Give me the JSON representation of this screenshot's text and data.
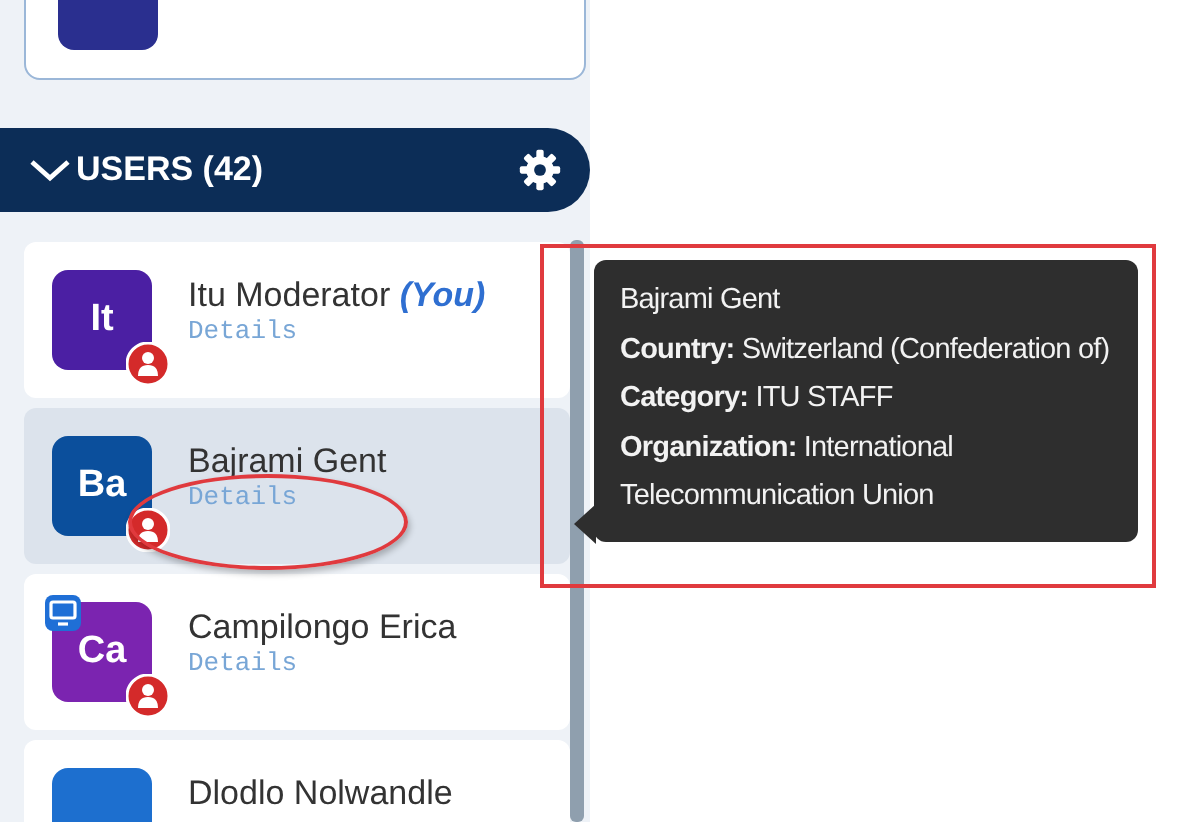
{
  "users_section": {
    "title": "USERS (42)",
    "expanded": true
  },
  "users": [
    {
      "initials": "It",
      "color": "#4b1fa3",
      "name": "Itu Moderator",
      "you_label": "(You)",
      "details": "Details",
      "selected": false,
      "screen_sharing": false
    },
    {
      "initials": "Ba",
      "color": "#0b4f9c",
      "name": "Bajrami Gent",
      "details": "Details",
      "selected": true,
      "screen_sharing": false
    },
    {
      "initials": "Ca",
      "color": "#7b24b0",
      "name": "Campilongo Erica",
      "details": "Details",
      "selected": false,
      "screen_sharing": true
    },
    {
      "color": "#1d6fcf",
      "name": "Dlodlo Nolwandle",
      "selected": false,
      "screen_sharing": false
    }
  ],
  "tooltip": {
    "lines": [
      "Bajrami Gent",
      "**Country:** Switzerland (Confederation of)",
      "**Category:** ITU STAFF",
      "**Organization:** International Telecommunication Union"
    ]
  },
  "annotations": [
    {
      "kind": "ellipse"
    },
    {
      "kind": "rectangle"
    }
  ]
}
